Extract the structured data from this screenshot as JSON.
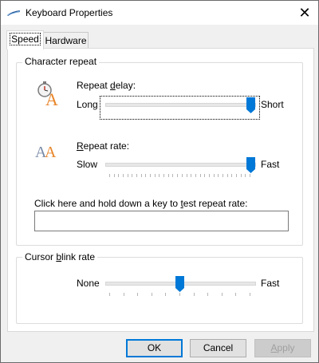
{
  "window": {
    "title": "Keyboard Properties",
    "close_glyph": "✕"
  },
  "tabs": [
    {
      "label": "Speed",
      "selected": true
    },
    {
      "label": "Hardware",
      "selected": false
    }
  ],
  "character_repeat": {
    "group_label": "Character repeat",
    "repeat_delay": {
      "label": "Repeat delay:",
      "mnemonic": "d",
      "min_label": "Long",
      "max_label": "Short",
      "value_fraction": 1.0,
      "icon": "stopwatch-letter-a-icon"
    },
    "repeat_rate": {
      "label": "Repeat rate:",
      "mnemonic": "R",
      "min_label": "Slow",
      "max_label": "Fast",
      "value_fraction": 1.0,
      "icon": "double-letter-a-icon"
    },
    "test_prompt": "Click here and hold down a key to test repeat rate:",
    "test_value": ""
  },
  "cursor_blink": {
    "group_label": "Cursor blink rate",
    "min_label": "None",
    "max_label": "Fast",
    "value_fraction": 0.5
  },
  "buttons": {
    "ok": "OK",
    "cancel": "Cancel",
    "apply": "Apply"
  },
  "colors": {
    "accent": "#0078d7",
    "icon_orange": "#e8862a"
  }
}
